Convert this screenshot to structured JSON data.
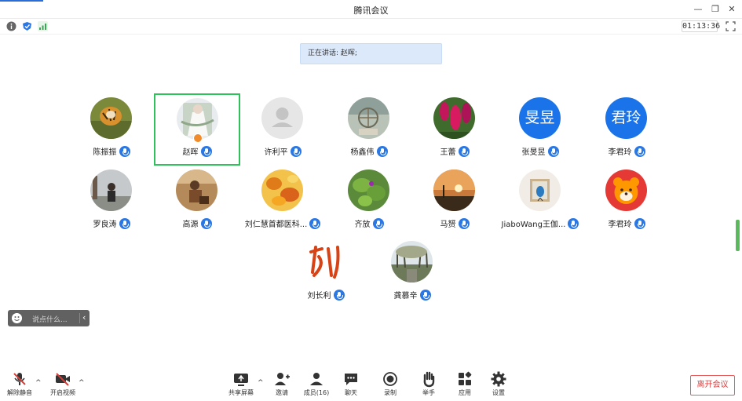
{
  "window": {
    "title": "腾讯会议"
  },
  "toolbar": {
    "timer": "01:13:36"
  },
  "speaking_banner": "正在讲话: 赵晖;",
  "participants": [
    {
      "name": "陈振振"
    },
    {
      "name": "赵晖"
    },
    {
      "name": "许利平"
    },
    {
      "name": "杨鑫伟"
    },
    {
      "name": "王蕾"
    },
    {
      "name": "张旻昱",
      "avatar_text": "旻昱"
    },
    {
      "name": "李君玲",
      "avatar_text": "君玲"
    },
    {
      "name": "罗良涛"
    },
    {
      "name": "高源"
    },
    {
      "name": "刘仁慧首都医科..."
    },
    {
      "name": "齐放"
    },
    {
      "name": "马赟"
    },
    {
      "name": "JiaboWang王伽..."
    },
    {
      "name": "李君玲"
    },
    {
      "name": "刘长利",
      "avatar_text": "刘"
    },
    {
      "name": "龚慕辛"
    }
  ],
  "chat": {
    "placeholder": "说点什么..."
  },
  "bottom": {
    "unmute": "解除静音",
    "video": "开启视频",
    "share": "共享屏幕",
    "invite": "邀请",
    "members": "成员(16)",
    "chat": "聊天",
    "record": "录制",
    "raise_hand": "举手",
    "apps": "应用",
    "settings": "设置",
    "leave": "离开会议"
  },
  "colors": {
    "accent": "#2b78e4",
    "active_border": "#2fc25b",
    "leave": "#e03b3b"
  }
}
